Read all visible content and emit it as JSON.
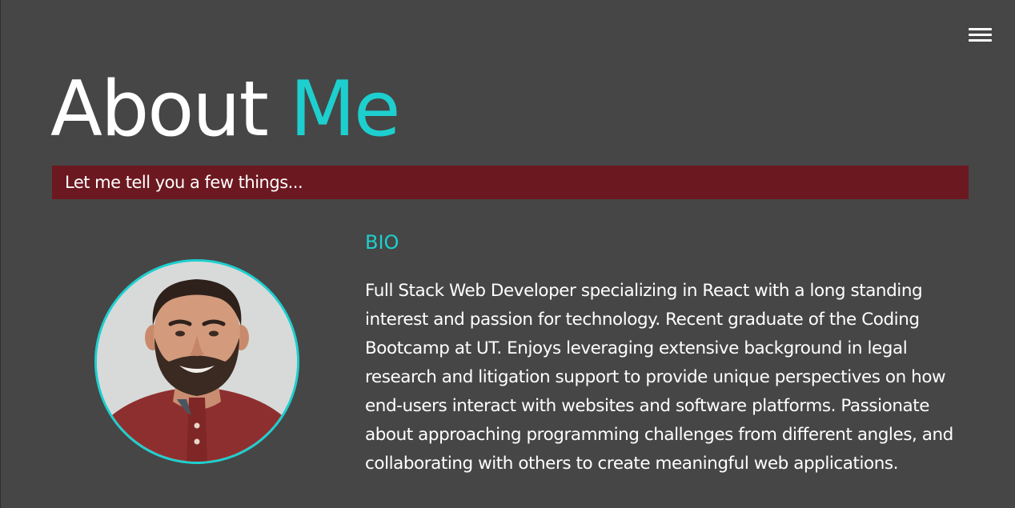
{
  "header": {
    "menu_icon": "hamburger-menu-icon"
  },
  "title": {
    "part1": "About",
    "part2": "Me"
  },
  "tagline": "Let me tell you a few things...",
  "bio": {
    "heading": "BIO",
    "text": "Full Stack Web Developer specializing in React with a long standing interest and passion for technology. Recent graduate of the Coding Bootcamp at UT. Enjoys leveraging extensive background in legal research and litigation support to provide unique perspectives on how end-users interact with websites and software platforms. Passionate about approaching programming challenges from different angles, and collaborating with others to create meaningful web applications."
  },
  "colors": {
    "background": "#464646",
    "accent": "#1ecfcf",
    "tagline_bar": "#6c1820",
    "text": "#ffffff"
  }
}
